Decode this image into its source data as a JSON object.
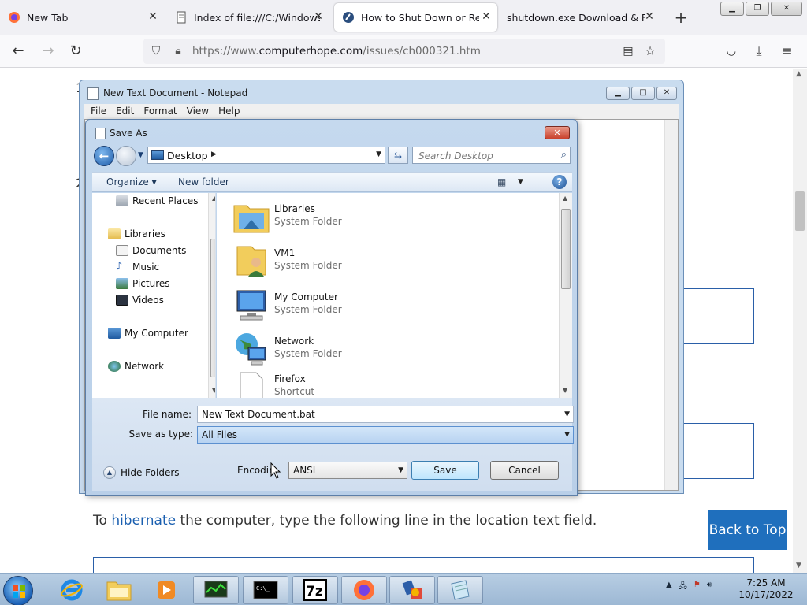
{
  "browser": {
    "tabs": [
      {
        "label": "New Tab",
        "active": false
      },
      {
        "label": "Index of file:///C:/Windows/",
        "active": false
      },
      {
        "label": "How to Shut Down or Restart",
        "active": true
      },
      {
        "label": "shutdown.exe Download & Fix Fo",
        "active": false
      }
    ],
    "url_prefix": "https://www.",
    "url_domain": "computerhope.com",
    "url_path": "/issues/ch000321.htm"
  },
  "page": {
    "hibernate_pre": "To ",
    "hibernate_link": "hibernate",
    "hibernate_post": " the computer, type the following line in the location text field.",
    "back_to_top": "Back to Top",
    "step1": "1",
    "step2": "2"
  },
  "notepad": {
    "title": "New Text Document - Notepad",
    "menu": [
      "File",
      "Edit",
      "Format",
      "View",
      "Help"
    ]
  },
  "saveas": {
    "title": "Save As",
    "address": "Desktop",
    "search_placeholder": "Search Desktop",
    "organize": "Organize ▾",
    "new_folder": "New folder",
    "tree": [
      "Recent Places",
      "Libraries",
      "Documents",
      "Music",
      "Pictures",
      "Videos",
      "My Computer",
      "Network"
    ],
    "files": [
      {
        "name": "Libraries",
        "type": "System Folder"
      },
      {
        "name": "VM1",
        "type": "System Folder"
      },
      {
        "name": "My Computer",
        "type": "System Folder"
      },
      {
        "name": "Network",
        "type": "System Folder"
      },
      {
        "name": "Firefox",
        "type": "Shortcut"
      }
    ],
    "file_name_label": "File name:",
    "file_name_value": "New Text Document.bat",
    "save_type_label": "Save as type:",
    "save_type_value": "All Files",
    "hide_folders": "Hide Folders",
    "encoding_label": "Encodin",
    "encoding_value": "ANSI",
    "save_button": "Save",
    "cancel_button": "Cancel"
  },
  "taskbar": {
    "time": "7:25 AM",
    "date": "10/17/2022"
  }
}
